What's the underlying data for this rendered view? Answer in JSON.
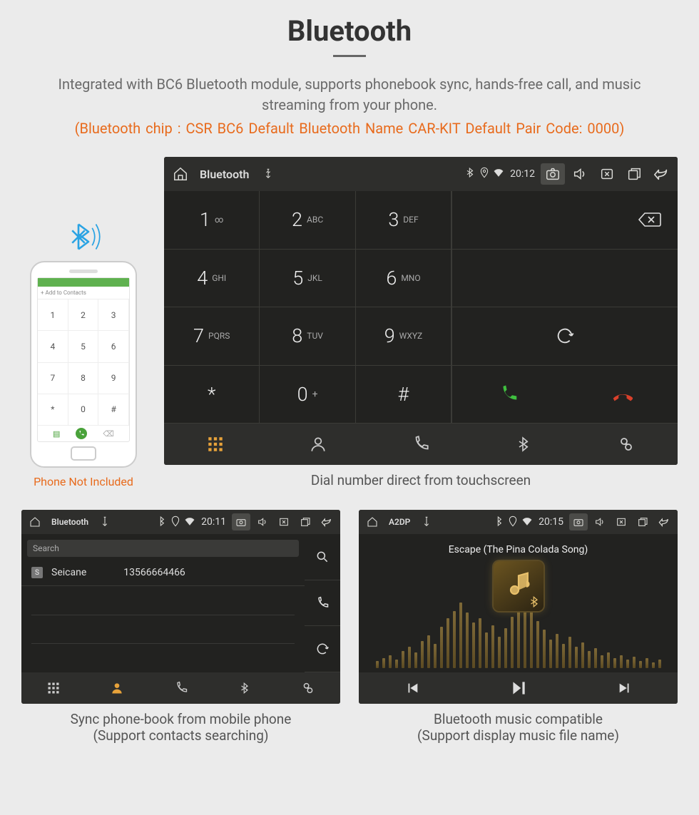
{
  "header": {
    "title": "Bluetooth",
    "description": "Integrated with BC6 Bluetooth module, supports phonebook sync, hands-free call, and music streaming from your phone.",
    "spec_line": "(Bluetooth chip : CSR BC6     Default Bluetooth Name CAR-KIT     Default Pair Code: 0000)"
  },
  "phone_mock": {
    "add_contacts_label": "+  Add to Contacts",
    "caption": "Phone Not Included"
  },
  "dialer_screen": {
    "topbar_title": "Bluetooth",
    "clock": "20:12",
    "keys": [
      {
        "num": "1",
        "letters": "∞"
      },
      {
        "num": "2",
        "letters": "ABC"
      },
      {
        "num": "3",
        "letters": "DEF"
      },
      {
        "num": "4",
        "letters": "GHI"
      },
      {
        "num": "5",
        "letters": "JKL"
      },
      {
        "num": "6",
        "letters": "MNO"
      },
      {
        "num": "7",
        "letters": "PQRS"
      },
      {
        "num": "8",
        "letters": "TUV"
      },
      {
        "num": "9",
        "letters": "WXYZ"
      },
      {
        "num": "*",
        "letters": ""
      },
      {
        "num": "0",
        "letters": "+",
        "sup": true
      },
      {
        "num": "#",
        "letters": ""
      }
    ],
    "caption": "Dial number direct from touchscreen"
  },
  "phonebook_screen": {
    "topbar_title": "Bluetooth",
    "clock": "20:11",
    "search_placeholder": "Search",
    "contact": {
      "badge": "S",
      "name": "Seicane",
      "number": "13566664466"
    },
    "caption_line1": "Sync phone-book from mobile phone",
    "caption_line2": "(Support contacts searching)"
  },
  "music_screen": {
    "topbar_title": "A2DP",
    "clock": "20:15",
    "track_name": "Escape (The Pina Colada Song)",
    "caption_line1": "Bluetooth music compatible",
    "caption_line2": "(Support display music file name)"
  }
}
